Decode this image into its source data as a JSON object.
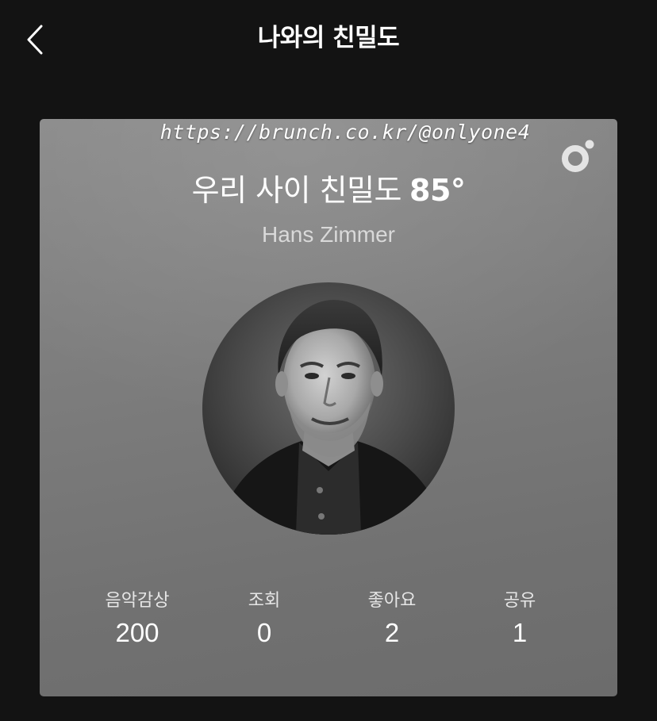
{
  "header": {
    "title": "나와의 친밀도",
    "back_icon": "chevron-left-icon"
  },
  "card": {
    "watermark": "https://brunch.co.kr/@onlyone4",
    "brand_icon": "app-logo-icon",
    "headline_prefix": "우리 사이 친밀도",
    "intimacy_degree": "85°",
    "artist_name": "Hans Zimmer",
    "photo": "artist-photo",
    "stats": [
      {
        "label": "음악감상",
        "value": "200"
      },
      {
        "label": "조회",
        "value": "0"
      },
      {
        "label": "좋아요",
        "value": "2"
      },
      {
        "label": "공유",
        "value": "1"
      }
    ]
  },
  "colors": {
    "background": "#131313",
    "card_top": "#8a8a8a",
    "card_bottom": "#6c6c6c",
    "text": "#ffffff"
  }
}
